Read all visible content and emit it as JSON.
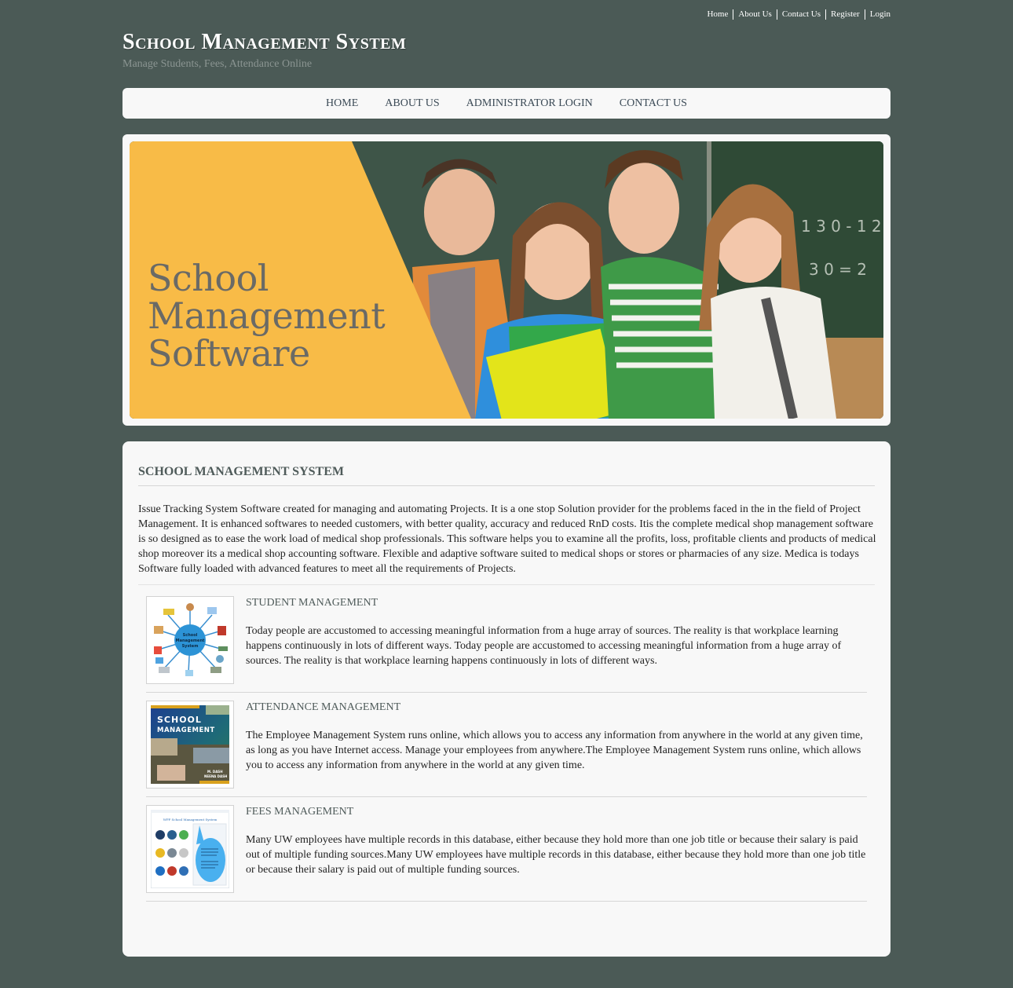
{
  "top_links": [
    "Home",
    "About Us",
    "Contact Us",
    "Register",
    "Login"
  ],
  "site": {
    "title": "School Management System",
    "tagline": "Manage Students, Fees, Attendance Online"
  },
  "nav": {
    "items": [
      "HOME",
      "ABOUT US",
      "ADMINISTRATOR LOGIN",
      "CONTACT US"
    ]
  },
  "hero": {
    "lines": [
      "School",
      "Management",
      "Software"
    ],
    "colors": {
      "banner": "#f8bb47",
      "chalkboard": "#3e5548"
    }
  },
  "main": {
    "title": "SCHOOL MANAGEMENT SYSTEM",
    "intro": "Issue Tracking System Software created for managing and automating Projects. It is a one stop Solution provider for the problems faced in the in the field of Project Management. It is enhanced softwares to needed customers, with better quality, accuracy and reduced RnD costs. Itis the complete medical shop management software is so designed as to ease the work load of medical shop professionals. This software helps you to examine all the profits, loss, profitable clients and products of medical shop moreover its a medical shop accounting software. Flexible and adaptive software suited to medical shops or stores or pharmacies of any size. Medica is todays Software fully loaded with advanced features to meet all the requirements of Projects.",
    "features": [
      {
        "title": "STUDENT MANAGEMENT",
        "text": "Today people are accustomed to accessing meaningful information from a huge array of sources. The reality is that workplace learning happens continuously in lots of different ways. Today people are accustomed to accessing meaningful information from a huge array of sources. The reality is that workplace learning happens continuously in lots of different ways.",
        "thumb_label": "School Management System"
      },
      {
        "title": "ATTENDANCE MANAGEMENT",
        "text": "The Employee Management System runs online, which allows you to access any information from anywhere in the world at any given time, as long as you have Internet access. Manage your employees from anywhere.The Employee Management System runs online, which allows you to access any information from anywhere in the world at any given time.",
        "thumb_label": "SCHOOL MANAGEMENT",
        "thumb_authors": "M. DASH / NEENA DASH"
      },
      {
        "title": "FEES MANAGEMENT",
        "text": "Many UW employees have multiple records in this database, either because they hold more than one job title or because their salary is paid out of multiple funding sources.Many UW employees have multiple records in this database, either because they hold more than one job title or because their salary is paid out of multiple funding sources.",
        "thumb_label": "WPF School Management System"
      }
    ]
  },
  "colors": {
    "page_bg": "#4b5a56",
    "panel_bg": "#f8f8f8",
    "nav_text": "#3b4a56",
    "heading_text": "#4f5b5a"
  }
}
